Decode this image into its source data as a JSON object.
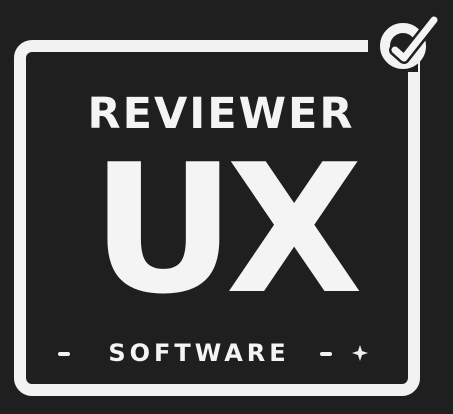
{
  "logo": {
    "title": "REVIEWER",
    "mark": "UX",
    "subtitle": "SOFTWARE",
    "icons": {
      "badge": "checkmark-badge-icon",
      "decoration_left": "dash-icon",
      "decoration_right": "dash-icon",
      "sparkle": "sparkle-icon"
    }
  },
  "colors": {
    "background": "#1f1f1f",
    "foreground": "#f4f4f4"
  }
}
